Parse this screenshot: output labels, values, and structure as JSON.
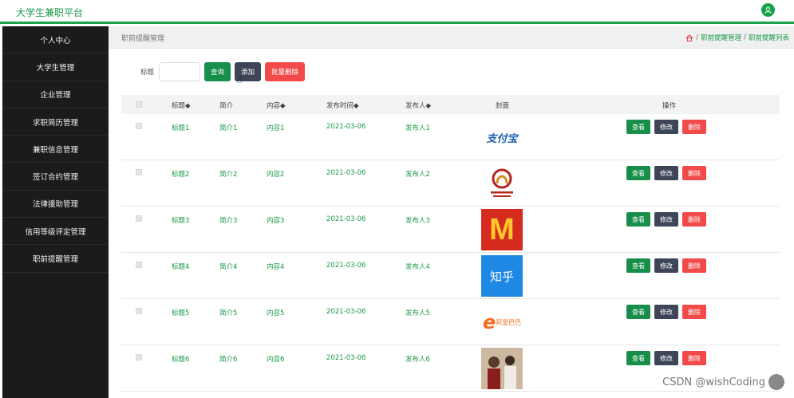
{
  "app": {
    "title": "大学生兼职平台"
  },
  "sidebar": {
    "items": [
      {
        "label": "个人中心"
      },
      {
        "label": "大学生管理"
      },
      {
        "label": "企业管理"
      },
      {
        "label": "求职简历管理"
      },
      {
        "label": "兼职信息管理"
      },
      {
        "label": "签订合约管理"
      },
      {
        "label": "法律援助管理"
      },
      {
        "label": "信用等级评定管理"
      },
      {
        "label": "职前提醒管理"
      }
    ]
  },
  "breadcrumb": {
    "page_title": "职前提醒管理",
    "items": [
      "职前提醒管理",
      "职前提醒列表"
    ],
    "separator": "/"
  },
  "toolbar": {
    "search_label": "标题",
    "search_value": "",
    "query_label": "查询",
    "add_label": "添加",
    "batch_delete_label": "批量删除"
  },
  "table": {
    "headers": {
      "title": "标题◆",
      "intro": "简介",
      "content": "内容◆",
      "publish_time": "发布时间◆",
      "publisher": "发布人◆",
      "cover": "封面",
      "actions": "操作"
    },
    "rows": [
      {
        "title": "标题1",
        "intro": "简介1",
        "content": "内容1",
        "publish_time": "2021-03-06",
        "publisher": "发布人1",
        "cover_text": "支付宝",
        "cover_icon": "alipay-logo"
      },
      {
        "title": "标题2",
        "intro": "简介2",
        "content": "内容2",
        "publish_time": "2021-03-06",
        "publisher": "发布人2",
        "cover_text": "",
        "cover_icon": "emblem-logo"
      },
      {
        "title": "标题3",
        "intro": "简介3",
        "content": "内容3",
        "publish_time": "2021-03-06",
        "publisher": "发布人3",
        "cover_text": "M",
        "cover_icon": "mcdonalds-logo"
      },
      {
        "title": "标题4",
        "intro": "简介4",
        "content": "内容4",
        "publish_time": "2021-03-06",
        "publisher": "发布人4",
        "cover_text": "知乎",
        "cover_icon": "zhihu-logo"
      },
      {
        "title": "标题5",
        "intro": "简介5",
        "content": "内容5",
        "publish_time": "2021-03-06",
        "publisher": "发布人5",
        "cover_text": "阿里巴巴",
        "cover_icon": "alibaba-logo"
      },
      {
        "title": "标题6",
        "intro": "简介6",
        "content": "内容6",
        "publish_time": "2021-03-06",
        "publisher": "发布人6",
        "cover_text": "",
        "cover_icon": "photo-thumbnail"
      }
    ],
    "actions": {
      "view": "查看",
      "edit": "修改",
      "delete": "删除"
    }
  },
  "watermark": {
    "text": "CSDN @wishCoding"
  },
  "colors": {
    "brand_green": "#1a9a47",
    "button_green": "#178e4a",
    "button_dark": "#3d4657",
    "button_red": "#f24a4a",
    "sidebar_bg": "#1b1b1b"
  }
}
